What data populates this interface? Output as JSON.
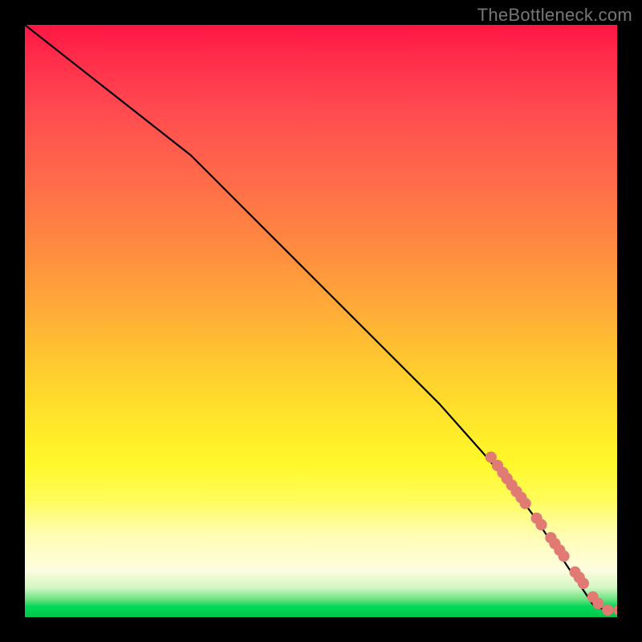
{
  "watermark": "TheBottleneck.com",
  "colors": {
    "dot": "#e17a72",
    "curve": "#000000",
    "background_black": "#000000"
  },
  "chart_data": {
    "type": "line",
    "title": "",
    "xlabel": "",
    "ylabel": "",
    "xlim": [
      0,
      100
    ],
    "ylim": [
      0,
      100
    ],
    "series": [
      {
        "name": "bottleneck-curve",
        "x": [
          0,
          28,
          40,
          50,
          60,
          70,
          78,
          83,
          86,
          88,
          90,
          92,
          94,
          96,
          98,
          100
        ],
        "y": [
          100,
          78,
          66,
          56,
          46,
          36,
          27,
          21,
          17,
          14,
          11,
          8,
          5,
          2,
          1.2,
          1.2
        ]
      }
    ],
    "points": [
      {
        "name": "p1",
        "x": 78.7,
        "y": 27.0
      },
      {
        "name": "p2",
        "x": 79.8,
        "y": 25.6
      },
      {
        "name": "p3",
        "x": 80.7,
        "y": 24.4
      },
      {
        "name": "p4",
        "x": 81.4,
        "y": 23.4
      },
      {
        "name": "p5",
        "x": 82.2,
        "y": 22.3
      },
      {
        "name": "p6",
        "x": 83.0,
        "y": 21.2
      },
      {
        "name": "p7",
        "x": 83.8,
        "y": 20.2
      },
      {
        "name": "p8",
        "x": 84.5,
        "y": 19.2
      },
      {
        "name": "p9",
        "x": 86.4,
        "y": 16.7
      },
      {
        "name": "p10",
        "x": 87.2,
        "y": 15.6
      },
      {
        "name": "p11",
        "x": 88.8,
        "y": 13.4
      },
      {
        "name": "p12",
        "x": 89.5,
        "y": 12.4
      },
      {
        "name": "p13",
        "x": 90.3,
        "y": 11.3
      },
      {
        "name": "p14",
        "x": 91.0,
        "y": 10.3
      },
      {
        "name": "p15",
        "x": 92.9,
        "y": 7.6
      },
      {
        "name": "p16",
        "x": 93.6,
        "y": 6.7
      },
      {
        "name": "p17",
        "x": 94.3,
        "y": 5.7
      },
      {
        "name": "p18",
        "x": 95.9,
        "y": 3.4
      },
      {
        "name": "p19",
        "x": 96.8,
        "y": 2.3
      },
      {
        "name": "p20",
        "x": 98.4,
        "y": 1.2
      },
      {
        "name": "p21",
        "x": 100.3,
        "y": 1.2
      }
    ]
  }
}
